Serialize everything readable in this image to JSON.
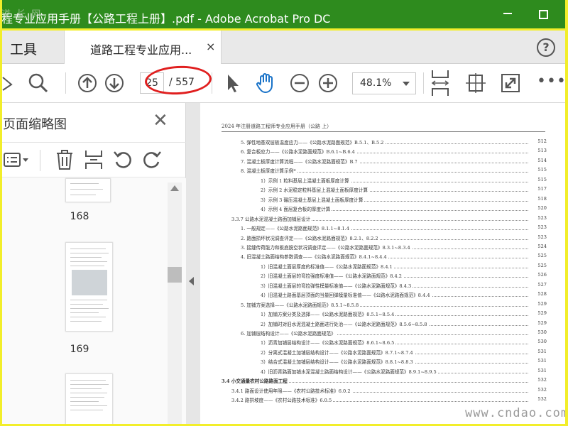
{
  "window": {
    "title": "程专业应用手册【公路工程上册】.pdf - Adobe Acrobat Pro DC",
    "watermark_tl": "道 长 网"
  },
  "tabs": {
    "tools": "工具",
    "document": "道路工程专业应用...",
    "close": "×"
  },
  "toolbar": {
    "page_current": "25",
    "page_total": "/ 557",
    "zoom": "48.1%"
  },
  "panel": {
    "title": "页面缩略图",
    "thumb_labels": [
      "168",
      "169"
    ]
  },
  "document": {
    "header": "2024 年注册道路工程师专业应用手册（公路 上）",
    "toc": [
      {
        "indent": 1,
        "text": "5. 弹性地基双层板温度应力——《公路水泥路面规范》B.5.1、B.5.2",
        "page": "512"
      },
      {
        "indent": 1,
        "text": "6. 复合板应力——《公路水泥路面规范》B.6.1~B.6.4",
        "page": "513"
      },
      {
        "indent": 1,
        "text": "7. 混凝土板厚度计算流程——《公路水泥路面规范》B.7",
        "page": "514"
      },
      {
        "indent": 1,
        "text": "8. 混凝土板厚度计算示例*",
        "page": "515"
      },
      {
        "indent": 2,
        "text": "1）示例 1  粒料基层上混凝土面板厚度计算",
        "page": "515"
      },
      {
        "indent": 2,
        "text": "2）示例 2  水泥稳定粒料基层上混凝土面板厚度计算",
        "page": "517"
      },
      {
        "indent": 2,
        "text": "3）示例 3  碾压混凝土基层上混凝土面板厚度计算",
        "page": "518"
      },
      {
        "indent": 2,
        "text": "4）示例 4  面层复合板的厚度计算",
        "page": "520"
      },
      {
        "indent": 0,
        "text": "3.3.7 公路水泥混凝土路面加铺层设计",
        "page": "523"
      },
      {
        "indent": 1,
        "text": "1. 一般规定——《公路水泥路面规范》8.1.1~8.1.4",
        "page": "523"
      },
      {
        "indent": 1,
        "text": "2. 路面损坏状况调查评定——《公路水泥路面规范》8.2.1、8.2.2",
        "page": "523"
      },
      {
        "indent": 1,
        "text": "3. 接缝传荷能力和板底脱空状况调查评定——《公路水泥路面规范》8.3.1~8.3.4",
        "page": "524"
      },
      {
        "indent": 1,
        "text": "4. 旧混凝土路面结构参数调查——《公路水泥路面规范》8.4.1~8.4.4",
        "page": "525"
      },
      {
        "indent": 2,
        "text": "1）旧混凝土面层厚度的标准值——《公路水泥路面规范》8.4.1",
        "page": "525"
      },
      {
        "indent": 2,
        "text": "2）旧混凝土面层的弯拉强度标准值——《公路水泥路面规范》8.4.2",
        "page": "526"
      },
      {
        "indent": 2,
        "text": "3）旧混凝土面层的弯拉弹性模量标准值——《公路水泥路面规范》8.4.3",
        "page": "527"
      },
      {
        "indent": 2,
        "text": "4）旧混凝土路面基层顶面的当量回弹模量标准值——《公路水泥路面规范》8.4.4",
        "page": "528"
      },
      {
        "indent": 1,
        "text": "5. 加铺方案选择——《公路水泥路面规范》8.5.1~8.5.8",
        "page": "529"
      },
      {
        "indent": 2,
        "text": "1）加铺方案分类及选择——《公路水泥路面规范》8.5.1~8.5.4",
        "page": "529"
      },
      {
        "indent": 2,
        "text": "2）加铺时对旧水泥混凝土路面进行处治——《公路水泥路面规范》8.5.6~8.5.8",
        "page": "529"
      },
      {
        "indent": 1,
        "text": "6. 加铺层结构设计——《公路水泥路面规范》",
        "page": "530"
      },
      {
        "indent": 2,
        "text": "1）沥青加铺层结构设计——《公路水泥路面规范》8.6.1~8.6.5",
        "page": "530"
      },
      {
        "indent": 2,
        "text": "2）分离式混凝土加铺层结构设计——《公路水泥路面规范》8.7.1~8.7.4",
        "page": "531"
      },
      {
        "indent": 2,
        "text": "3）结合式混凝土加铺层结构设计——《公路水泥路面规范》8.8.1~8.8.3",
        "page": "531"
      },
      {
        "indent": 2,
        "text": "4）旧沥青路面加铺水泥混凝土路面结构设计——《公路水泥路面规范》8.9.1~8.9.5",
        "page": "531"
      },
      {
        "indent": -1,
        "text": "3.4  小交通量农村公路路面工程",
        "page": "532",
        "bold": true
      },
      {
        "indent": 0,
        "text": "3.4.1 路面设计使用年限——《农村公路技术标准》6.0.2",
        "page": "532"
      },
      {
        "indent": 0,
        "text": "3.4.2 路拱坡度——《农村公路技术标准》6.0.5",
        "page": "532"
      }
    ]
  },
  "watermark": "www.cndao.com"
}
